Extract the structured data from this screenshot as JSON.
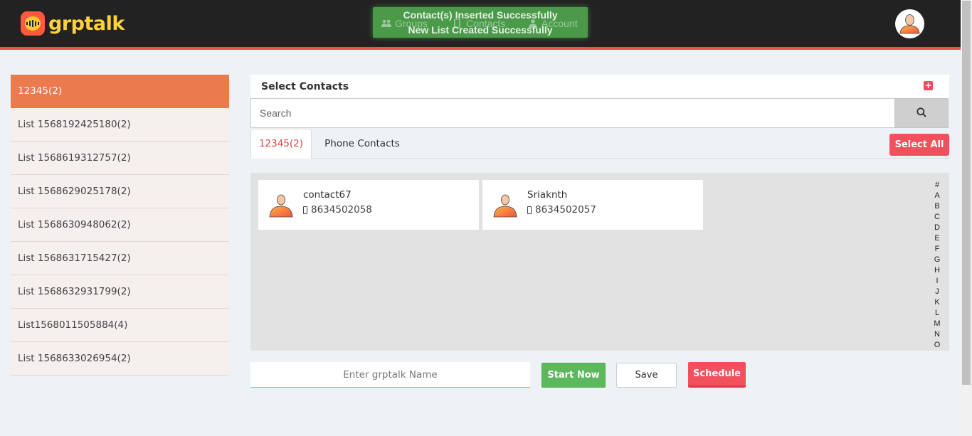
{
  "app": {
    "brand": "grptalk",
    "brand_color": "#ffd23c",
    "accent": "#ef4f4f"
  },
  "header": {
    "nav": [
      {
        "label": "Groups",
        "icon": "users-icon"
      },
      {
        "label": "Contacts",
        "icon": "phone-icon"
      },
      {
        "label": "Account",
        "icon": "user-icon"
      }
    ],
    "toasts": [
      "Contact(s) Inserted Successfully",
      "New List Created Successfully"
    ],
    "avatar_icon": "user-avatar-icon"
  },
  "sidebar": {
    "items": [
      {
        "label": "12345(2)",
        "active": true
      },
      {
        "label": "List 1568192425180(2)"
      },
      {
        "label": "List 1568619312757(2)"
      },
      {
        "label": "List 1568629025178(2)"
      },
      {
        "label": "List 1568630948062(2)"
      },
      {
        "label": "List 1568631715427(2)"
      },
      {
        "label": "List 1568632931799(2)"
      },
      {
        "label": "List1568011505884(4)"
      },
      {
        "label": "List 1568633026954(2)"
      }
    ]
  },
  "main": {
    "title": "Select Contacts",
    "add_icon": "plus-square-icon",
    "search": {
      "placeholder": "Search",
      "value": "",
      "icon": "search-icon"
    },
    "tabs": [
      {
        "label": "12345(2)",
        "active": true
      },
      {
        "label": "Phone Contacts"
      }
    ],
    "select_all_label": "Select All",
    "contacts": [
      {
        "name": "contact67",
        "phone": "8634502058"
      },
      {
        "name": "Sriaknth",
        "phone": "8634502057"
      }
    ],
    "alphabet": [
      "#",
      "A",
      "B",
      "C",
      "D",
      "E",
      "F",
      "G",
      "H",
      "I",
      "J",
      "K",
      "L",
      "M",
      "N",
      "O"
    ]
  },
  "footer": {
    "name_placeholder": "Enter grptalk Name",
    "start_label": "Start Now",
    "save_label": "Save",
    "schedule_label": "Schedule"
  }
}
